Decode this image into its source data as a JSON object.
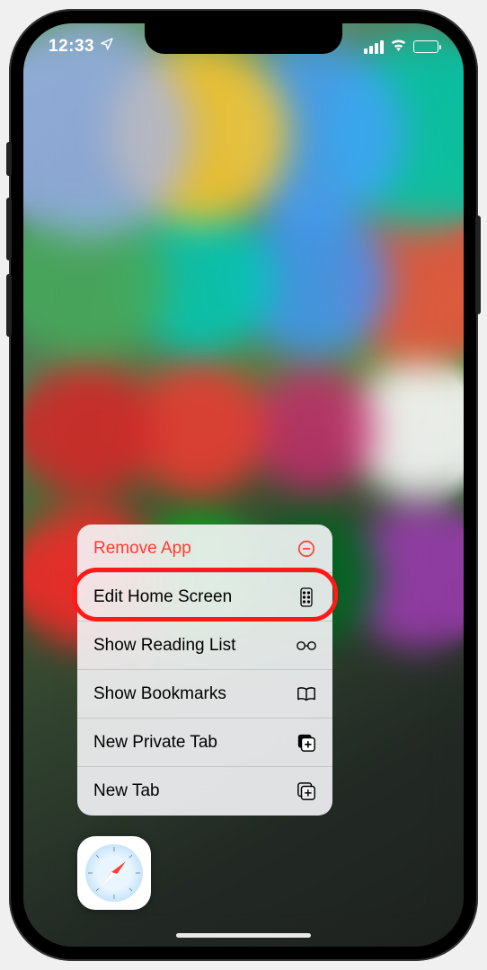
{
  "status": {
    "time": "12:33",
    "location_icon": "location-icon"
  },
  "menu": {
    "items": [
      {
        "label": "Remove App",
        "icon": "remove-circle-icon",
        "destructive": true
      },
      {
        "label": "Edit Home Screen",
        "icon": "apps-icon",
        "highlighted": true
      },
      {
        "label": "Show Reading List",
        "icon": "glasses-icon"
      },
      {
        "label": "Show Bookmarks",
        "icon": "book-icon"
      },
      {
        "label": "New Private Tab",
        "icon": "plus-square-fill-icon"
      },
      {
        "label": "New Tab",
        "icon": "plus-square-icon"
      }
    ]
  },
  "app": {
    "name": "Safari"
  }
}
